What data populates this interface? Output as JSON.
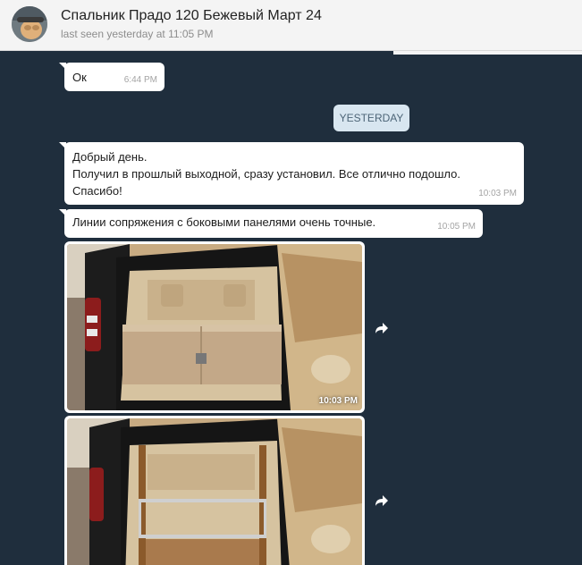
{
  "header": {
    "title": "Спальник Прадо 120 Бежевый Март 24",
    "status": "last seen yesterday at 11:05 PM"
  },
  "messages": {
    "m1": {
      "text": "Ок",
      "time": "6:44 PM"
    },
    "date_separator": "YESTERDAY",
    "m2": {
      "text": "Добрый день.\nПолучил в прошлый выходной, сразу установил. Все отлично подошло.\nСпасибо!",
      "time": "10:03 PM"
    },
    "m3": {
      "text": "Линии сопряжения с боковыми панелями очень точные.",
      "time": "10:05 PM"
    },
    "photo1": {
      "time": "10:03 PM",
      "icon": "forward-icon"
    },
    "photo2": {
      "icon": "forward-icon"
    }
  },
  "colors": {
    "chat_background": "#1f2e3d",
    "bubble": "#ffffff",
    "date_separator": "#d8e6f0",
    "header": "#f4f4f4"
  }
}
